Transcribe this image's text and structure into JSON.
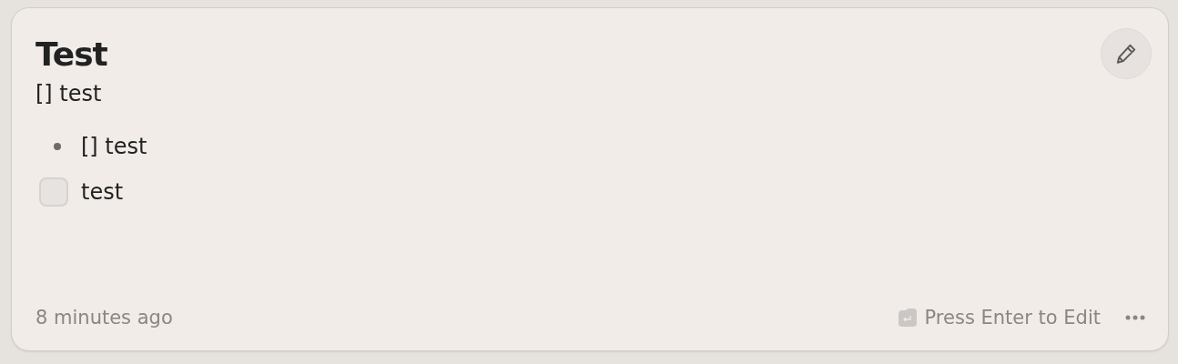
{
  "note": {
    "title": "Test",
    "blocks": [
      {
        "kind": "paragraph",
        "text": "[] test"
      },
      {
        "kind": "bullet",
        "text": "[] test"
      },
      {
        "kind": "checkbox",
        "text": "test",
        "checked": false
      }
    ],
    "timestamp": "8 minutes ago",
    "hint": "Press Enter to Edit"
  }
}
